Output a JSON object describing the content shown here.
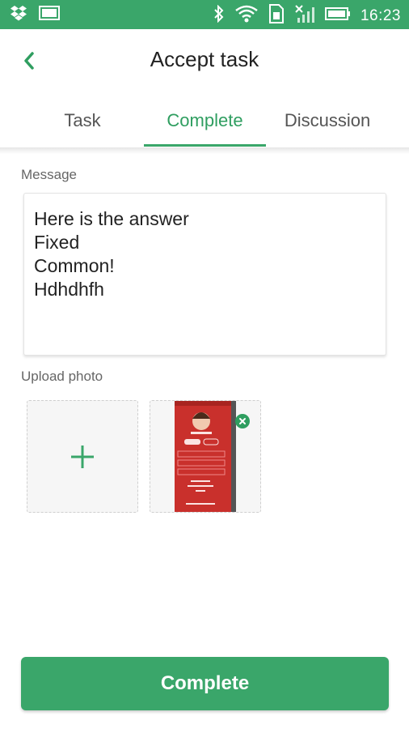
{
  "status_bar": {
    "time": "16:23",
    "left_icons": [
      "dropbox-icon",
      "screen-icon"
    ],
    "right_icons": [
      "bluetooth-icon",
      "wifi-icon",
      "sim-icon",
      "signal-icon",
      "battery-icon"
    ]
  },
  "app_bar": {
    "title": "Accept task",
    "back_icon": "chevron-left-icon"
  },
  "tabs": [
    {
      "label": "Task",
      "active": false
    },
    {
      "label": "Complete",
      "active": true
    },
    {
      "label": "Discussion",
      "active": false
    }
  ],
  "message": {
    "label": "Message",
    "value": "Here is the answer\nFixed\nCommon!\nHdhdhfh"
  },
  "upload": {
    "label": "Upload photo",
    "add_icon": "plus-icon",
    "remove_icon": "close-icon"
  },
  "complete_button": {
    "label": "Complete"
  },
  "colors": {
    "accent": "#3aa66a",
    "accent_text": "#2f9e60"
  }
}
